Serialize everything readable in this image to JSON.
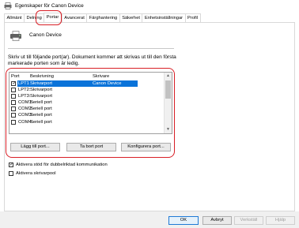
{
  "window": {
    "title": "Egenskaper för Canon Device"
  },
  "tabs": [
    {
      "label": "Allmänt",
      "active": false
    },
    {
      "label": "Delning",
      "active": false
    },
    {
      "label": "Portar",
      "active": true
    },
    {
      "label": "Avancerat",
      "active": false
    },
    {
      "label": "Färghantering",
      "active": false
    },
    {
      "label": "Säkerhet",
      "active": false
    },
    {
      "label": "Enhetsinställningar",
      "active": false
    },
    {
      "label": "Profil",
      "active": false
    }
  ],
  "device": {
    "name": "Canon Device"
  },
  "instructions": "Skriv ut till följande port(ar). Dokument kommer att skrivas ut till den första markerade porten som är ledig.",
  "port_list": {
    "columns": {
      "port": "Port",
      "description": "Beskrivning",
      "printer": "Skrivare"
    },
    "rows": [
      {
        "port": "LPT1:",
        "description": "Skrivarport",
        "printer": "Canon Device",
        "checked": true,
        "selected": true
      },
      {
        "port": "LPT2:",
        "description": "Skrivarport",
        "printer": "",
        "checked": false,
        "selected": false
      },
      {
        "port": "LPT3:",
        "description": "Skrivarport",
        "printer": "",
        "checked": false,
        "selected": false
      },
      {
        "port": "COM1:",
        "description": "Seriell port",
        "printer": "",
        "checked": false,
        "selected": false
      },
      {
        "port": "COM2:",
        "description": "Seriell port",
        "printer": "",
        "checked": false,
        "selected": false
      },
      {
        "port": "COM3:",
        "description": "Seriell port",
        "printer": "",
        "checked": false,
        "selected": false
      },
      {
        "port": "COM4:",
        "description": "Seriell port",
        "printer": "",
        "checked": false,
        "selected": false
      }
    ]
  },
  "port_buttons": {
    "add": "Lägg till port...",
    "remove": "Ta bort port",
    "configure": "Konfigurera port..."
  },
  "options": {
    "bidirectional": {
      "label": "Aktivera stöd för dubbelriktad kommunikation",
      "checked": true
    },
    "pooling": {
      "label": "Aktivera skrivarpool",
      "checked": false
    }
  },
  "dialog_buttons": {
    "ok": "OK",
    "cancel": "Avbryt",
    "apply": "Verkställ",
    "help": "Hjälp"
  },
  "colors": {
    "highlight": "#d81f26",
    "selection": "#0a73d9"
  }
}
